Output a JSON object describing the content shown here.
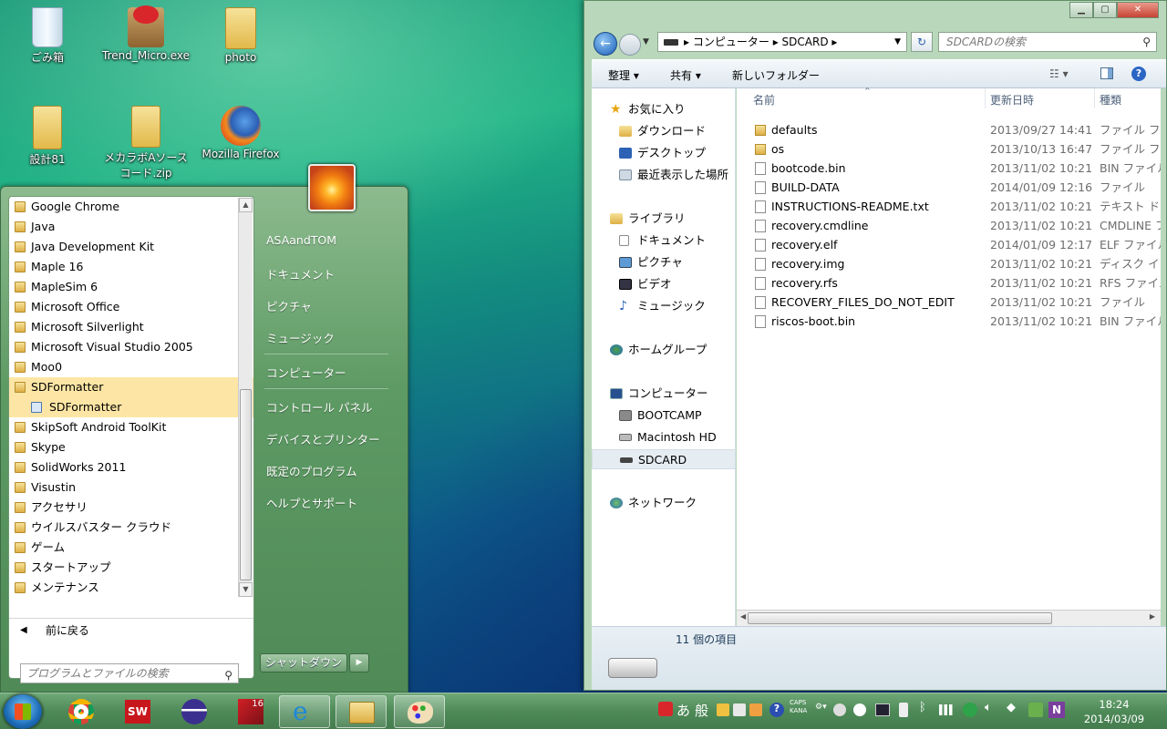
{
  "desktop": {
    "icons": [
      {
        "label": "ごみ箱"
      },
      {
        "label": "Trend_Micro.exe"
      },
      {
        "label": "photo"
      },
      {
        "label": "設計81"
      },
      {
        "label": "メカラボAソースコード.zip"
      },
      {
        "label": "Mozilla Firefox"
      }
    ]
  },
  "start_menu": {
    "programs": [
      "Google Chrome",
      "Java",
      "Java Development Kit",
      "Maple 16",
      "MapleSim 6",
      "Microsoft Office",
      "Microsoft Silverlight",
      "Microsoft Visual Studio 2005",
      "Moo0",
      "SDFormatter",
      "SDFormatter",
      "SkipSoft Android ToolKit",
      "Skype",
      "SolidWorks 2011",
      "Visustin",
      "アクセサリ",
      "ウイルスバスター クラウド",
      "ゲーム",
      "スタートアップ",
      "メンテナンス"
    ],
    "back_label": "前に戻る",
    "search_placeholder": "プログラムとファイルの検索",
    "right_items": [
      "ASAandTOM",
      "ドキュメント",
      "ピクチャ",
      "ミュージック",
      "コンピューター",
      "コントロール パネル",
      "デバイスとプリンター",
      "既定のプログラム",
      "ヘルプとサポート"
    ],
    "shutdown_label": "シャットダウン"
  },
  "explorer": {
    "breadcrumb": [
      "コンピューター",
      "SDCARD"
    ],
    "search_placeholder": "SDCARDの検索",
    "toolbar": {
      "organize": "整理 ▾",
      "share": "共有 ▾",
      "new_folder": "新しいフォルダー"
    },
    "nav": {
      "favorites": "お気に入り",
      "favorites_items": [
        "ダウンロード",
        "デスクトップ",
        "最近表示した場所"
      ],
      "libraries": "ライブラリ",
      "libraries_items": [
        "ドキュメント",
        "ピクチャ",
        "ビデオ",
        "ミュージック"
      ],
      "homegroup": "ホームグループ",
      "computer": "コンピューター",
      "computer_items": [
        "BOOTCAMP",
        "Macintosh HD",
        "SDCARD"
      ],
      "network": "ネットワーク"
    },
    "columns": {
      "name": "名前",
      "date": "更新日時",
      "type": "種類"
    },
    "files": [
      {
        "name": "defaults",
        "date": "2013/09/27 14:41",
        "type": "ファイル フォ"
      },
      {
        "name": "os",
        "date": "2013/10/13 16:47",
        "type": "ファイル フォ"
      },
      {
        "name": "bootcode.bin",
        "date": "2013/11/02 10:21",
        "type": "BIN ファイル"
      },
      {
        "name": "BUILD-DATA",
        "date": "2014/01/09 12:16",
        "type": "ファイル"
      },
      {
        "name": "INSTRUCTIONS-README.txt",
        "date": "2013/11/02 10:21",
        "type": "テキスト ドキ"
      },
      {
        "name": "recovery.cmdline",
        "date": "2013/11/02 10:21",
        "type": "CMDLINE ファ"
      },
      {
        "name": "recovery.elf",
        "date": "2014/01/09 12:17",
        "type": "ELF ファイル"
      },
      {
        "name": "recovery.img",
        "date": "2013/11/02 10:21",
        "type": "ディスク イメ"
      },
      {
        "name": "recovery.rfs",
        "date": "2013/11/02 10:21",
        "type": "RFS ファイル"
      },
      {
        "name": "RECOVERY_FILES_DO_NOT_EDIT",
        "date": "2013/11/02 10:21",
        "type": "ファイル"
      },
      {
        "name": "riscos-boot.bin",
        "date": "2013/11/02 10:21",
        "type": "BIN ファイル"
      }
    ],
    "status": "11 個の項目"
  },
  "taskbar": {
    "ime": [
      "あ",
      "般"
    ],
    "caps": "CAPS",
    "kana": "KANA",
    "time": "18:24",
    "date": "2014/03/09"
  }
}
